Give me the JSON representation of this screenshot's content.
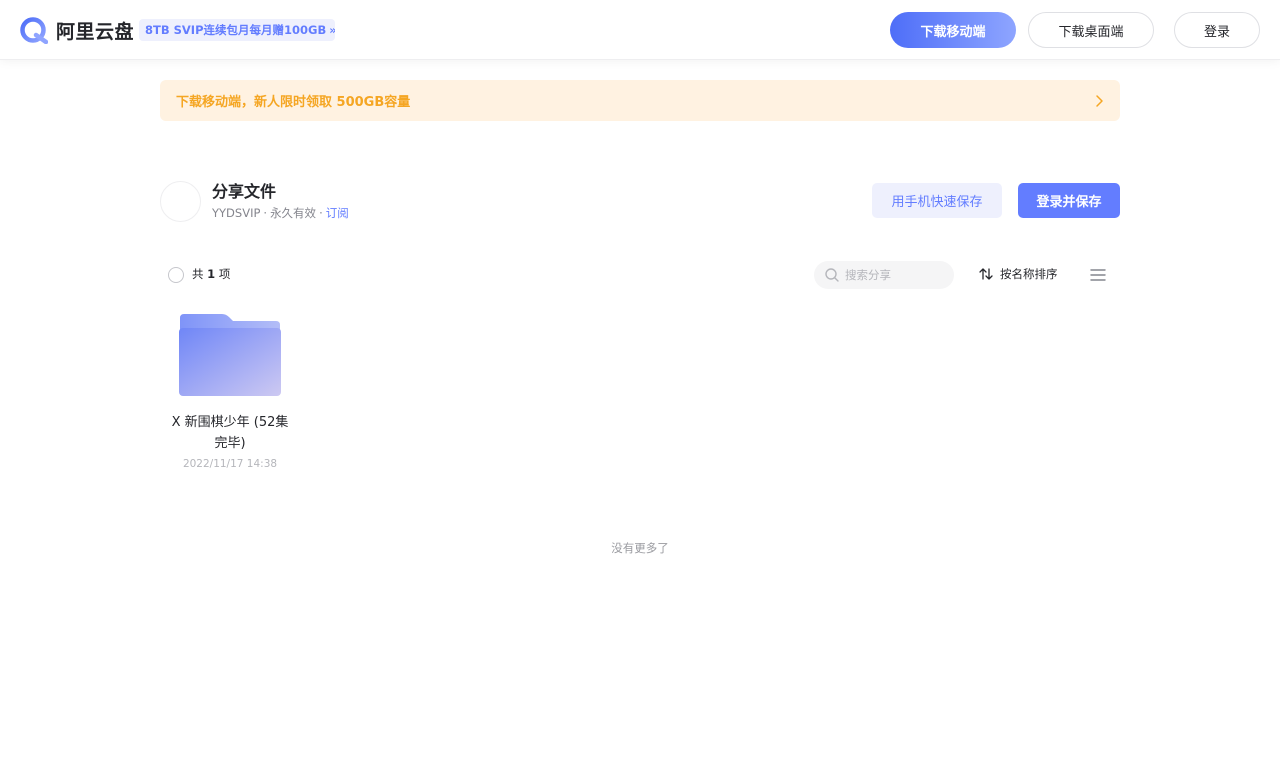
{
  "header": {
    "brand": "阿里云盘",
    "promo": "8TB SVIP连续包月每月赠100GB",
    "promo_chevron": "»",
    "download_mobile": "下载移动端",
    "download_desktop": "下载桌面端",
    "login": "登录",
    "accent_color": "#637dff"
  },
  "banner": {
    "text": "下载移动端，新人限时领取 500GB容量",
    "icon": "chevron-right-icon",
    "color": "#f5a623"
  },
  "share": {
    "title": "分享文件",
    "owner": "YYDSVIP",
    "separator": "·",
    "validity": "永久有效",
    "subscribe": "订阅",
    "phone_save": "用手机快速保存",
    "login_save": "登录并保存"
  },
  "toolbar": {
    "count_prefix": "共",
    "count_value": "1",
    "count_suffix": "项",
    "search_placeholder": "搜索分享",
    "sort_label": "按名称排序",
    "icons": [
      "search-icon",
      "sort-icon",
      "list-view-icon"
    ]
  },
  "files": [
    {
      "name": "X 新围棋少年 (52集完毕)",
      "date": "2022/11/17 14:38",
      "type": "folder"
    }
  ],
  "footer": {
    "no_more": "没有更多了"
  }
}
